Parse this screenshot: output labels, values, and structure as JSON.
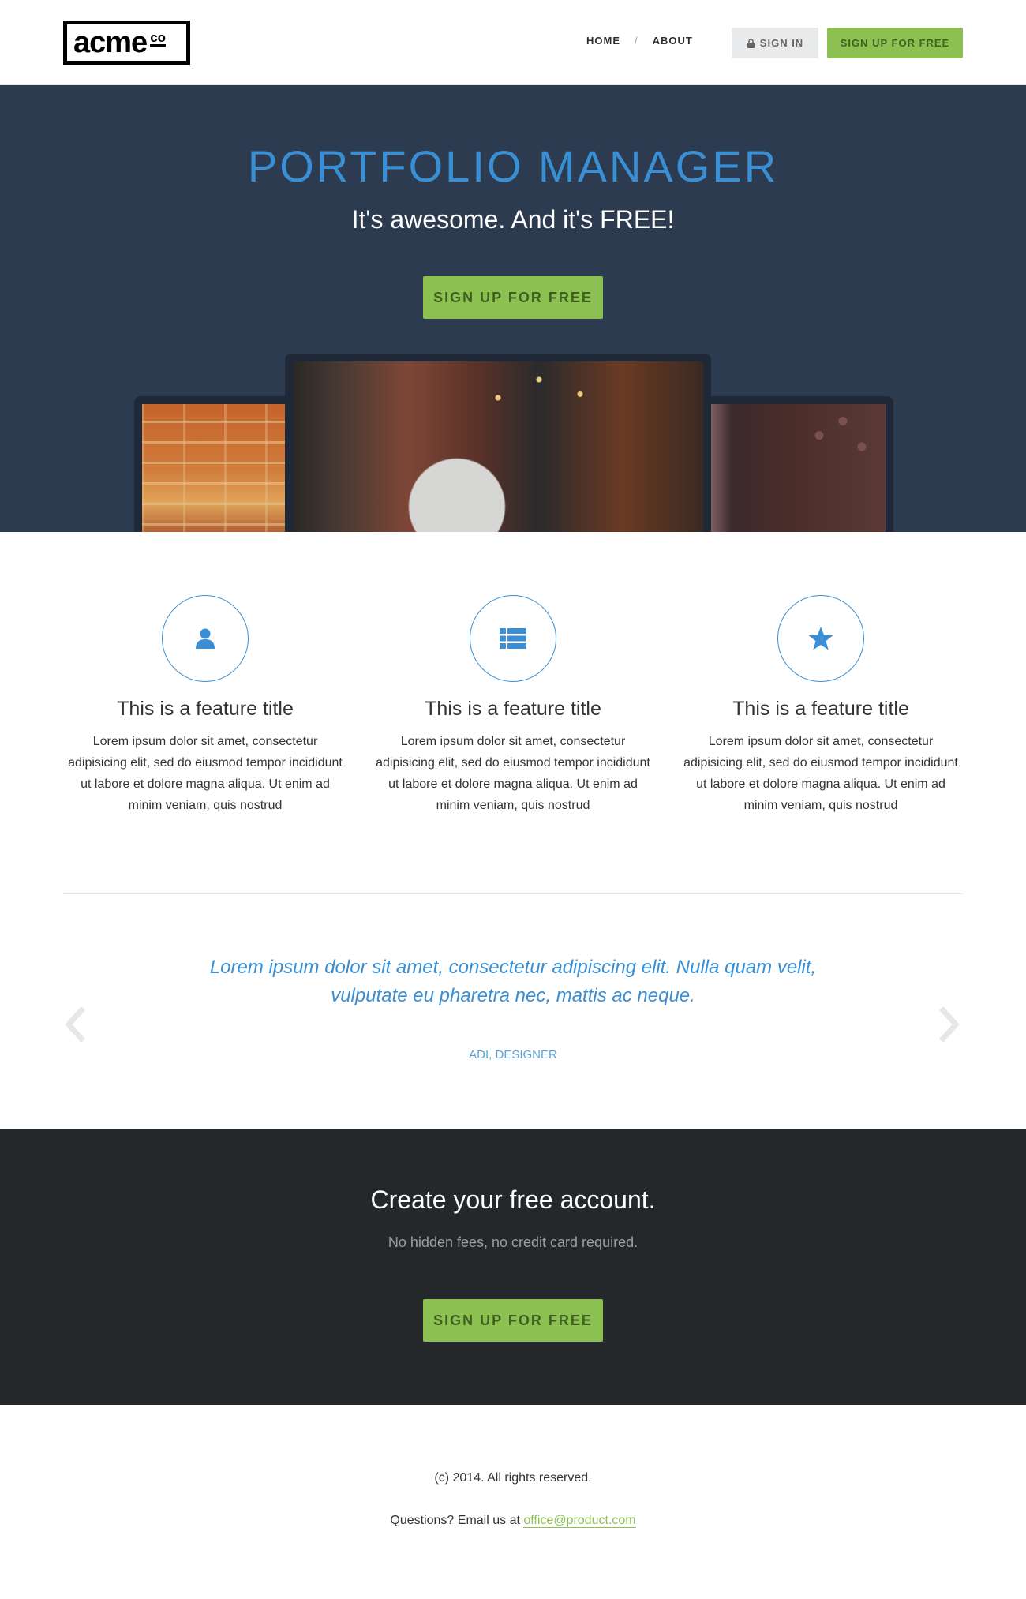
{
  "logo": {
    "main": "acme",
    "co": "co"
  },
  "nav": {
    "home": "HOME",
    "separator": "/",
    "about": "ABOUT"
  },
  "header_buttons": {
    "sign_in": "SIGN IN",
    "sign_up": "SIGN UP FOR FREE"
  },
  "hero": {
    "title": "PORTFOLIO MANAGER",
    "subtitle": "It's awesome. And it's FREE!",
    "button": "SIGN UP FOR FREE"
  },
  "features": [
    {
      "icon": "user-icon",
      "title": "This is a feature title",
      "text": "Lorem ipsum dolor sit amet, consectetur adipisicing elit, sed do eiusmod tempor incididunt ut labore et dolore magna aliqua. Ut enim ad minim veniam, quis nostrud"
    },
    {
      "icon": "list-icon",
      "title": "This is a feature title",
      "text": "Lorem ipsum dolor sit amet, consectetur adipisicing elit, sed do eiusmod tempor incididunt ut labore et dolore magna aliqua. Ut enim ad minim veniam, quis nostrud"
    },
    {
      "icon": "star-icon",
      "title": "This is a feature title",
      "text": "Lorem ipsum dolor sit amet, consectetur adipisicing elit, sed do eiusmod tempor incididunt ut labore et dolore magna aliqua. Ut enim ad minim veniam, quis nostrud"
    }
  ],
  "testimonial": {
    "quote": "Lorem ipsum dolor sit amet, consectetur adipiscing elit. Nulla quam velit, vulputate eu pharetra nec, mattis ac neque.",
    "author": "ADI, DESIGNER"
  },
  "cta": {
    "title": "Create your free account.",
    "subtitle": "No hidden fees, no credit card required.",
    "button": "SIGN UP FOR FREE"
  },
  "footer": {
    "copyright": "(c) 2014. All rights reserved.",
    "contact_prefix": "Questions? Email us at ",
    "email": "office@product.com"
  },
  "colors": {
    "accent_blue": "#3a8fd4",
    "accent_green": "#8cc152",
    "hero_bg": "#2c3b4f",
    "cta_bg": "#25282b"
  }
}
